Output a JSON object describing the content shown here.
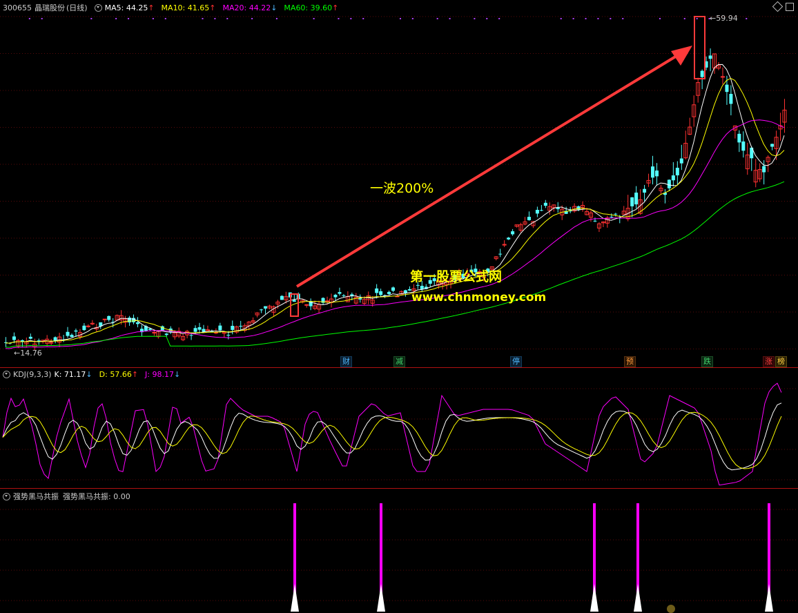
{
  "main": {
    "stock_code": "300655",
    "stock_name": "晶瑞股份",
    "period": "(日线)",
    "ma5_label": "MA5:",
    "ma5_value": "44.25",
    "ma10_label": "MA10:",
    "ma10_value": "41.65",
    "ma20_label": "MA20:",
    "ma20_value": "44.22",
    "ma60_label": "MA60:",
    "ma60_value": "39.60",
    "high_marker": "59.94",
    "low_marker": "14.76",
    "annotation": "一波200%",
    "watermark_line1": "第一股票公式网",
    "watermark_line2": "www.chnmoney.com",
    "event_tags": [
      "财",
      "减",
      "停",
      "预",
      "跌",
      "涨",
      "榜"
    ]
  },
  "kdj": {
    "title": "KDJ(9,3,3)",
    "k_label": "K:",
    "k_value": "71.17",
    "d_label": "D:",
    "d_value": "57.66",
    "j_label": "J:",
    "j_value": "98.17"
  },
  "indicator": {
    "title": "强势黑马共振",
    "value_label": "强势黑马共振:",
    "value": "0.00"
  },
  "colors": {
    "up": "#ff3232",
    "down": "#54ffff",
    "ma5": "#ffffff",
    "ma10": "#ffff00",
    "ma20": "#ff00ff",
    "ma60": "#00ff00",
    "kdj_k": "#ffffff",
    "kdj_d": "#ffff00",
    "kdj_j": "#ff00ff",
    "signal": "#ff00ff"
  }
}
